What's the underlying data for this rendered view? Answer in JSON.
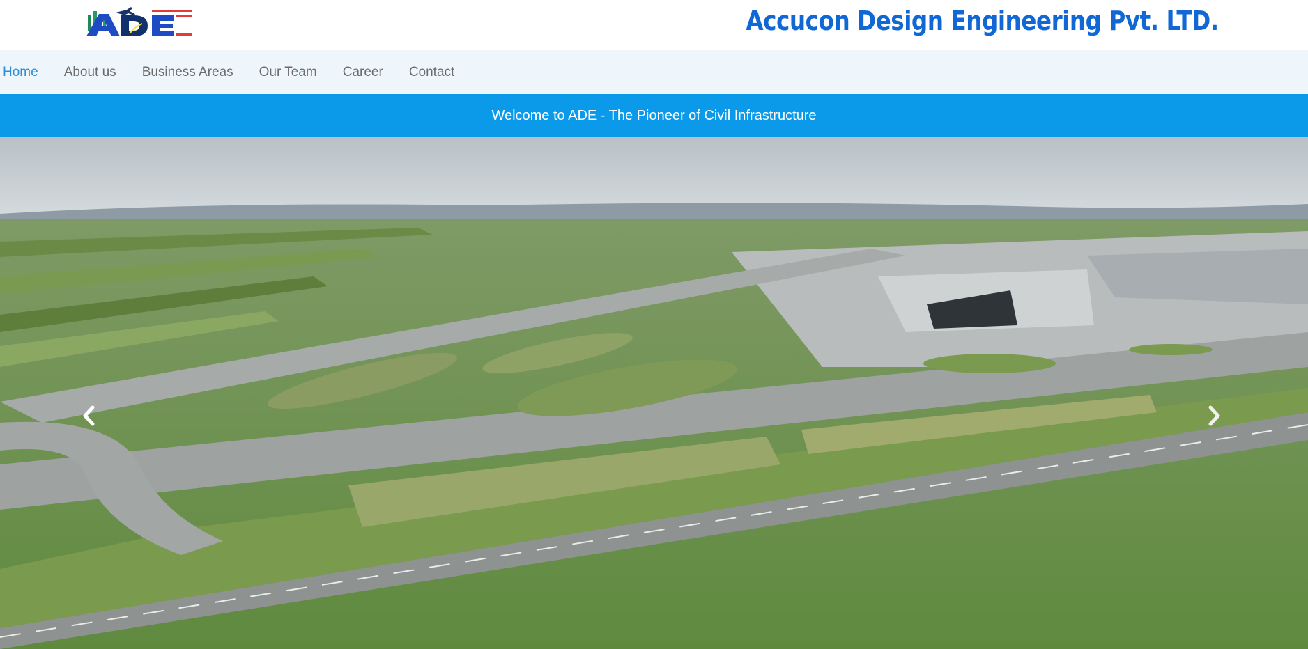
{
  "header": {
    "logo_text": "ADE",
    "company_name": "Accucon Design Engineering Pvt. LTD."
  },
  "nav": {
    "items": [
      {
        "label": "Home",
        "active": true
      },
      {
        "label": "About us",
        "active": false
      },
      {
        "label": "Business Areas",
        "active": false
      },
      {
        "label": "Our Team",
        "active": false
      },
      {
        "label": "Career",
        "active": false
      },
      {
        "label": "Contact",
        "active": false
      }
    ]
  },
  "banner": {
    "welcome_text": "Welcome to ADE - The Pioneer of Civil Infrastructure"
  },
  "carousel": {
    "prev_icon": "chevron-left-icon",
    "next_icon": "chevron-right-icon",
    "slide_subject": "aerial airport image"
  },
  "colors": {
    "brand_blue": "#1167d4",
    "banner_blue": "#0b9ae9",
    "nav_bg": "#eef6fc",
    "nav_active": "#2f8fd6",
    "nav_text": "#6b6b6b"
  }
}
